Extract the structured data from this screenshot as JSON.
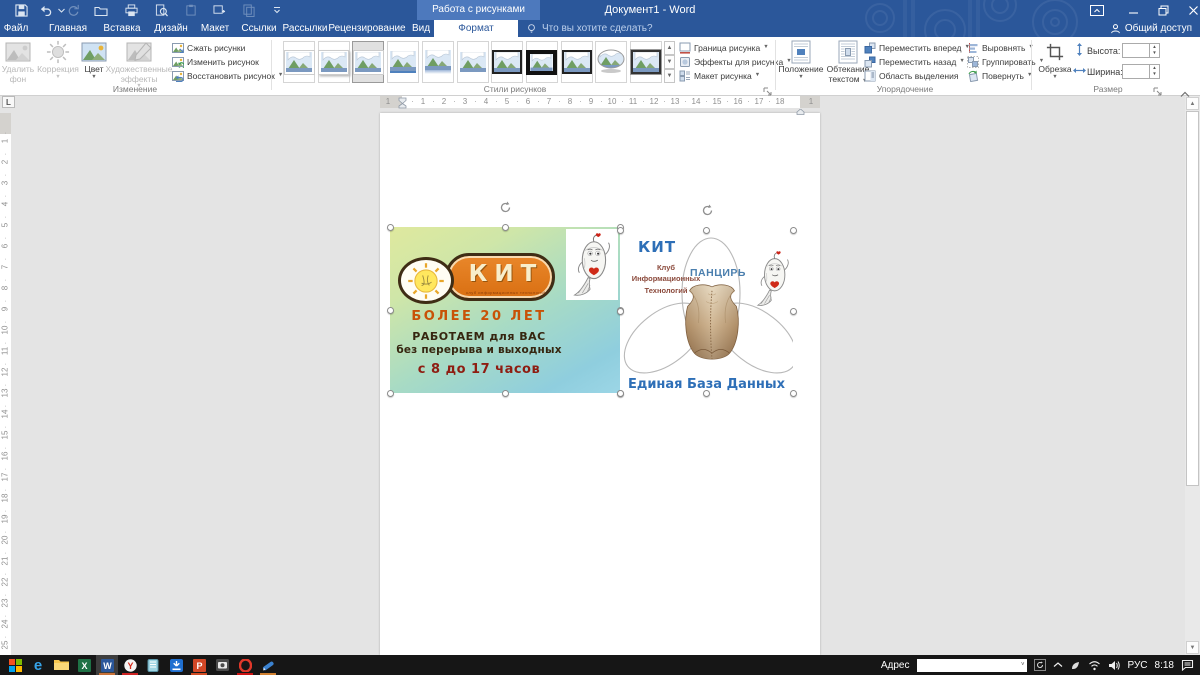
{
  "colors": {
    "accent": "#2b579a",
    "contextual_tab": "#4d79bd",
    "doc_bg": "#e4e4e4",
    "taskbar_bg": "#161616"
  },
  "titlebar": {
    "title": "Документ1 - Word",
    "contextual_header": "Работа с рисунками",
    "share_label": "Общий доступ",
    "qat": [
      {
        "name": "save-icon"
      },
      {
        "name": "undo-icon"
      },
      {
        "name": "undo-dropdown-icon"
      },
      {
        "name": "redo-icon",
        "disabled": true
      },
      {
        "name": "open-icon"
      },
      {
        "name": "print-icon"
      },
      {
        "name": "print-preview-icon"
      },
      {
        "name": "paste-icon",
        "disabled": true
      },
      {
        "name": "new-item-icon"
      },
      {
        "name": "copy-icon",
        "disabled": true
      },
      {
        "name": "qat-customize-icon"
      }
    ]
  },
  "tabs": {
    "items": [
      "Файл",
      "Главная",
      "Вставка",
      "Дизайн",
      "Макет",
      "Ссылки",
      "Рассылки",
      "Рецензирование",
      "Вид"
    ],
    "active": "Формат",
    "tellme": "Что вы хотите сделать?"
  },
  "ribbon": {
    "adjust": {
      "label": "Изменение",
      "big": [
        {
          "lines": [
            "Удалить",
            "фон"
          ],
          "disabled": true,
          "icon": "remove-background-icon",
          "caret": false
        },
        {
          "lines": [
            "Коррекция"
          ],
          "disabled": true,
          "icon": "corrections-icon",
          "caret": true
        },
        {
          "lines": [
            "Цвет"
          ],
          "disabled": false,
          "icon": "color-icon",
          "caret": true
        },
        {
          "lines": [
            "Художественные",
            "эффекты"
          ],
          "disabled": true,
          "icon": "artistic-effects-icon",
          "caret": true
        }
      ],
      "small": [
        {
          "label": "Сжать рисунки",
          "icon": "compress-pictures-icon",
          "caret": false
        },
        {
          "label": "Изменить рисунок",
          "icon": "change-picture-icon",
          "caret": false
        },
        {
          "label": "Восстановить рисунок",
          "icon": "reset-picture-icon",
          "caret": true
        }
      ]
    },
    "styles": {
      "label": "Стили рисунков",
      "gallery": [
        "frame-simple",
        "frame-white-shadow",
        "frame-selected",
        "soft-edge-bottom",
        "reflection",
        "plain",
        "frame-black",
        "frame-black-thick",
        "frame-black-thin",
        "oval-shadow",
        "frame-dark"
      ],
      "right": [
        {
          "label": "Граница рисунка",
          "icon": "picture-border-icon",
          "caret": true
        },
        {
          "label": "Эффекты для рисунка",
          "icon": "picture-effects-icon",
          "caret": true
        },
        {
          "label": "Макет рисунка",
          "icon": "picture-layout-icon",
          "caret": true
        }
      ]
    },
    "arrange": {
      "label": "Упорядочение",
      "position_lines": [
        "Положение",
        ""
      ],
      "wrap_lines": [
        "Обтекание",
        "текстом"
      ],
      "col1": [
        {
          "label": "Переместить вперед",
          "icon": "bring-forward-icon",
          "caret": true
        },
        {
          "label": "Переместить назад",
          "icon": "send-backward-icon",
          "caret": true
        },
        {
          "label": "Область выделения",
          "icon": "selection-pane-icon",
          "caret": false
        }
      ],
      "col2": [
        {
          "label": "Выровнять",
          "icon": "align-icon",
          "caret": true
        },
        {
          "label": "Группировать",
          "icon": "group-icon",
          "caret": true
        },
        {
          "label": "Повернуть",
          "icon": "rotate-icon",
          "caret": true
        }
      ]
    },
    "size": {
      "label": "Размер",
      "crop_label": "Обрезка",
      "height_label": "Высота:",
      "width_label": "Ширина:",
      "height_value": "",
      "width_value": ""
    }
  },
  "ruler": {
    "h_numbers": [
      "1",
      "2",
      "3",
      "4",
      "5",
      "6",
      "7",
      "8",
      "9",
      "10",
      "11",
      "12",
      "13",
      "14",
      "15",
      "16",
      "17",
      "18"
    ],
    "h_margin_left": "1",
    "h_margin_right": "1",
    "v_numbers": [
      "1",
      "2",
      "3",
      "4",
      "5",
      "6",
      "7",
      "8",
      "9",
      "10",
      "11",
      "12",
      "13",
      "14",
      "15",
      "16",
      "17",
      "18",
      "19",
      "20",
      "21",
      "22",
      "23",
      "24",
      "25"
    ]
  },
  "document": {
    "left_image": {
      "logo_text": "КИТ",
      "logo_subtext": "клуб информационных технологий",
      "line1": "БОЛЕЕ 20 ЛЕТ",
      "line2": "РАБОТАЕМ для ВАС",
      "line3": "без перерыва и выходных",
      "line4": "с 8 до 17 часов"
    },
    "right_image": {
      "title": "КИТ",
      "sub1": "Клуб",
      "sub2": "Информационных",
      "sub3": "Технологий",
      "product": "ПАНЦИРЬ",
      "caption": "Единая База Данных"
    }
  },
  "taskbar": {
    "items": [
      {
        "name": "start-button"
      },
      {
        "name": "edge-icon"
      },
      {
        "name": "explorer-icon"
      },
      {
        "name": "excel-icon"
      },
      {
        "name": "word-icon",
        "active": true,
        "underline": "#c87137"
      },
      {
        "name": "yandex-browser-icon",
        "underline": "#cc2222"
      },
      {
        "name": "notebook-app-icon"
      },
      {
        "name": "download-manager-icon"
      },
      {
        "name": "powerpoint-icon",
        "underline": "#d04b23"
      },
      {
        "name": "screenshot-app-icon"
      },
      {
        "name": "opera-icon",
        "underline": "#cc1111"
      },
      {
        "name": "graphics-app-icon",
        "underline": "#d08030"
      }
    ],
    "tray": {
      "address_label": "Адрес",
      "language": "РУС",
      "time": "8:18"
    }
  }
}
